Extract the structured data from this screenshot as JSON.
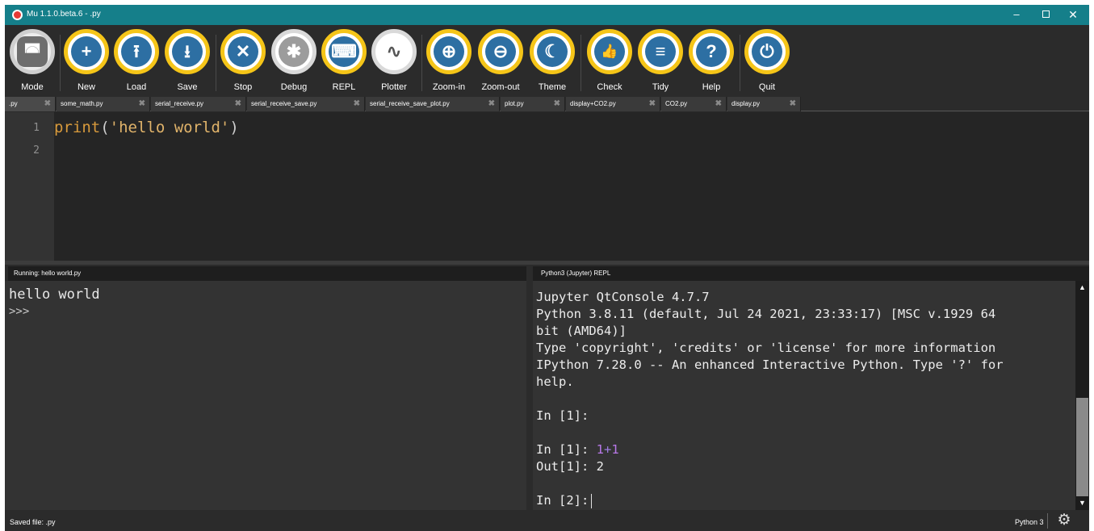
{
  "window": {
    "title": "Mu 1.1.0.beta.6 - .py",
    "controls": {
      "minimize": "–",
      "maximize": "",
      "close": "✕"
    }
  },
  "toolbar": {
    "buttons": [
      {
        "label": "Mode",
        "icon": "mode-icon",
        "glyph": "◚"
      },
      {
        "label": "New",
        "icon": "plus-icon",
        "glyph": "+"
      },
      {
        "label": "Load",
        "icon": "upload-icon",
        "glyph": "⭱"
      },
      {
        "label": "Save",
        "icon": "download-icon",
        "glyph": "⭳"
      },
      {
        "label": "Stop",
        "icon": "x-icon",
        "glyph": "✕"
      },
      {
        "label": "Debug",
        "icon": "bug-icon",
        "glyph": "✱"
      },
      {
        "label": "REPL",
        "icon": "keyboard-icon",
        "glyph": "⌨"
      },
      {
        "label": "Plotter",
        "icon": "pulse-icon",
        "glyph": "∿"
      },
      {
        "label": "Zoom-in",
        "icon": "zoom-in-icon",
        "glyph": "⊕"
      },
      {
        "label": "Zoom-out",
        "icon": "zoom-out-icon",
        "glyph": "⊖"
      },
      {
        "label": "Theme",
        "icon": "moon-icon",
        "glyph": "☾"
      },
      {
        "label": "Check",
        "icon": "thumbs-up-icon",
        "glyph": "👍"
      },
      {
        "label": "Tidy",
        "icon": "lines-icon",
        "glyph": "≡"
      },
      {
        "label": "Help",
        "icon": "question-icon",
        "glyph": "?"
      },
      {
        "label": "Quit",
        "icon": "power-icon",
        "glyph": "⏻"
      }
    ]
  },
  "tabs": [
    {
      "label": ".py",
      "close": "✖",
      "active": true
    },
    {
      "label": "some_math.py",
      "close": "✖"
    },
    {
      "label": "serial_receive.py",
      "close": "✖"
    },
    {
      "label": "serial_receive_save.py",
      "close": "✖"
    },
    {
      "label": "serial_receive_save_plot.py",
      "close": "✖"
    },
    {
      "label": "plot.py",
      "close": "✖"
    },
    {
      "label": "display+CO2.py",
      "close": "✖"
    },
    {
      "label": "CO2.py",
      "close": "✖"
    },
    {
      "label": "display.py",
      "close": "✖"
    }
  ],
  "editor": {
    "line_numbers": [
      "1",
      "2"
    ],
    "code_line1": {
      "fn": "print",
      "open": "(",
      "str": "'hello world'",
      "close": ")"
    }
  },
  "output_pane": {
    "header": "Running: hello world.py",
    "lines": [
      "hello world",
      ">>>"
    ]
  },
  "repl_pane": {
    "header": "Python3 (Jupyter) REPL",
    "banner": [
      "Jupyter QtConsole 4.7.7",
      "Python 3.8.11 (default, Jul 24 2021, 23:33:17) [MSC v.1929 64",
      "bit (AMD64)]",
      "Type 'copyright', 'credits' or 'license' for more information",
      "IPython 7.28.0 -- An enhanced Interactive Python. Type '?' for",
      "help."
    ],
    "prompt1_empty": "In [1]:",
    "prompt1": "In [1]: ",
    "input_a": "1",
    "input_op": "+",
    "input_b": "1",
    "output": "Out[1]: 2",
    "prompt2": "In [2]:",
    "scroll_up": "▲",
    "scroll_down": "▼"
  },
  "statusbar": {
    "left": "Saved file: .py",
    "mode": "Python 3",
    "gear_glyph": "⚙"
  }
}
